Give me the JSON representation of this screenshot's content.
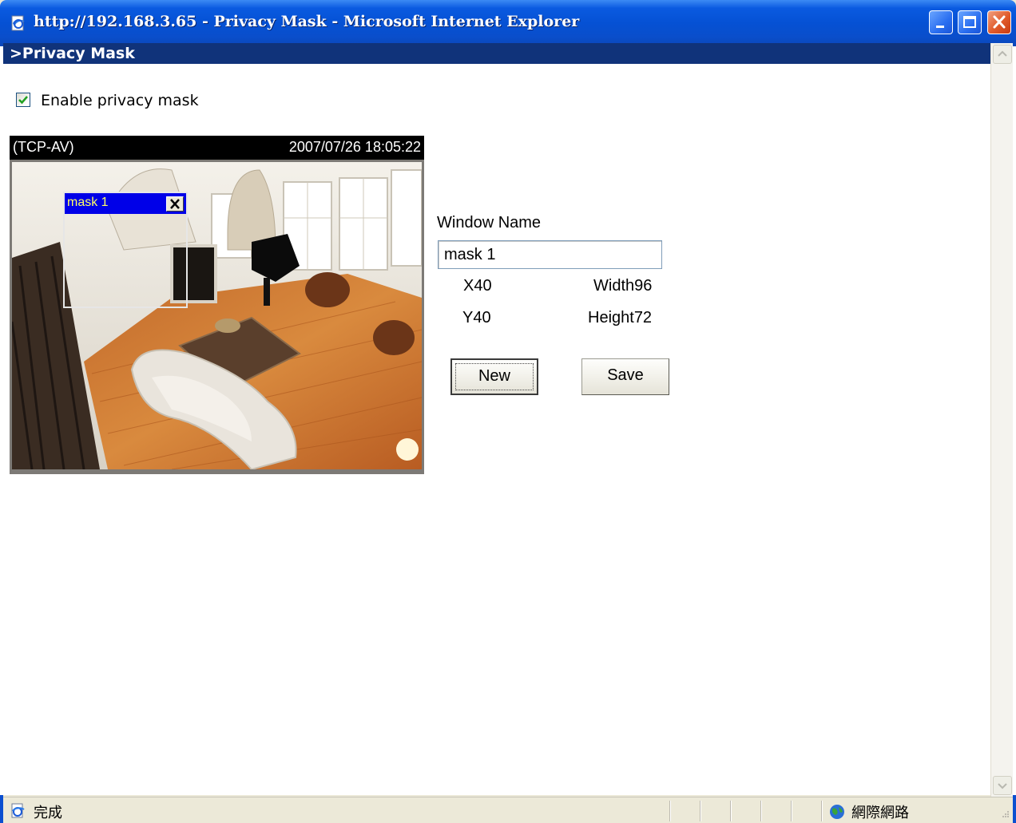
{
  "window": {
    "title": "http://192.168.3.65 - Privacy Mask - Microsoft Internet Explorer"
  },
  "page": {
    "header": ">Privacy Mask",
    "enable_label": "Enable privacy mask",
    "enable_checked": true
  },
  "video": {
    "protocol": "(TCP-AV)",
    "timestamp": "2007/07/26 18:05:22",
    "mask": {
      "label": "mask 1",
      "close_label": "✕"
    }
  },
  "form": {
    "window_name_label": "Window Name",
    "window_name_value": "mask 1",
    "x_label": "X40",
    "y_label": "Y40",
    "width_label": "Width96",
    "height_label": "Height72",
    "new_button": "New",
    "save_button": "Save"
  },
  "statusbar": {
    "status": "完成",
    "zone": "網際網路"
  },
  "colors": {
    "title_blue": "#0a5ae0",
    "header_navy": "#10337a",
    "mask_title": "#0000e8",
    "mask_text": "#ffff66"
  },
  "icons": [
    "ie-page-icon",
    "minimize-icon",
    "maximize-icon",
    "close-icon",
    "checkmark-icon",
    "scroll-up-icon",
    "scroll-down-icon",
    "done-page-icon",
    "internet-globe-icon",
    "resize-grip-icon"
  ]
}
